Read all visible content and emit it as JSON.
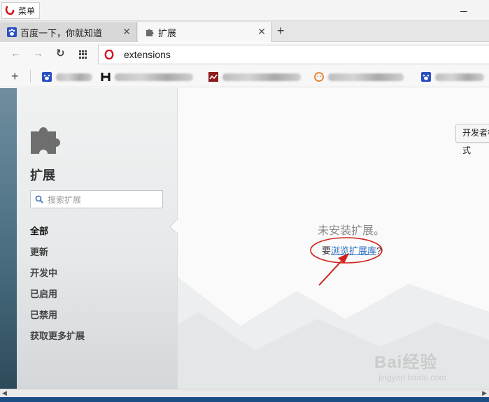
{
  "titlebar": {
    "menu_label": "菜单"
  },
  "tabs": [
    {
      "label": "百度一下，你就知道",
      "close": "✕"
    },
    {
      "label": "扩展",
      "close": "✕"
    }
  ],
  "new_tab": "+",
  "address": {
    "url": "extensions",
    "back": "←",
    "forward": "→",
    "reload": "↻"
  },
  "bookmarks": {
    "add": "+"
  },
  "sidebar": {
    "title": "扩展",
    "search_placeholder": "搜索扩展",
    "items": [
      {
        "label": "全部"
      },
      {
        "label": "更新"
      },
      {
        "label": "开发中"
      },
      {
        "label": "已启用"
      },
      {
        "label": "已禁用"
      },
      {
        "label": "获取更多扩展"
      }
    ]
  },
  "main": {
    "dev_button": "开发者模式",
    "empty_message": "未安装扩展。",
    "browse_prefix": "要",
    "browse_link": "浏览扩展库",
    "browse_suffix": "?"
  },
  "watermark": {
    "brand": "Bai经验",
    "url": "jingyan.baidu.com"
  },
  "colors": {
    "link": "#2a6fc2",
    "annotation": "#d0231b",
    "opera_red": "#d4111d"
  }
}
